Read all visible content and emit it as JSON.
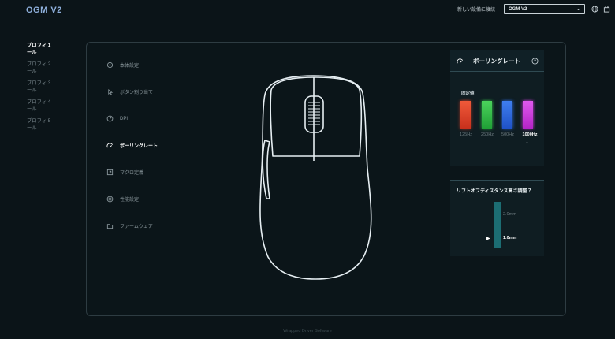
{
  "app": {
    "title": "OGM V2"
  },
  "header": {
    "connect_label": "新しい設備に接続",
    "device_selected": "OGM V2"
  },
  "profiles": [
    {
      "line1": "プロフィ 1",
      "line2": "ール"
    },
    {
      "line1": "プロフィ 2",
      "line2": "ール"
    },
    {
      "line1": "プロフィ 3",
      "line2": "ール"
    },
    {
      "line1": "プロフィ 4",
      "line2": "ール"
    },
    {
      "line1": "プロフィ 5",
      "line2": "ール"
    }
  ],
  "menu": [
    {
      "label": "本体設定",
      "icon": "settings-icon"
    },
    {
      "label": "ボタン割り当て",
      "icon": "pointer-icon"
    },
    {
      "label": "DPI",
      "icon": "dpi-icon"
    },
    {
      "label": "ポーリングレート",
      "icon": "polling-icon"
    },
    {
      "label": "マクロ定義",
      "icon": "macro-icon"
    },
    {
      "label": "性能設定",
      "icon": "performance-icon"
    },
    {
      "label": "ファームウェア",
      "icon": "firmware-icon"
    }
  ],
  "polling": {
    "title": "ポーリングレート",
    "section_label": "固定値",
    "rates": [
      {
        "label": "125Hz",
        "color": "#e8432a"
      },
      {
        "label": "250Hz",
        "color": "#36c24a"
      },
      {
        "label": "500Hz",
        "color": "#2f6fe6"
      },
      {
        "label": "1000Hz",
        "color": "#d23ce0"
      }
    ],
    "selected": "1000Hz"
  },
  "lod": {
    "title": "リフトオフディスタンス高さ調整 ？",
    "options": [
      "2.0mm",
      "1.0mm"
    ],
    "selected": "1.0mm"
  },
  "footer": {
    "text": "Wrapped Driver Software"
  }
}
